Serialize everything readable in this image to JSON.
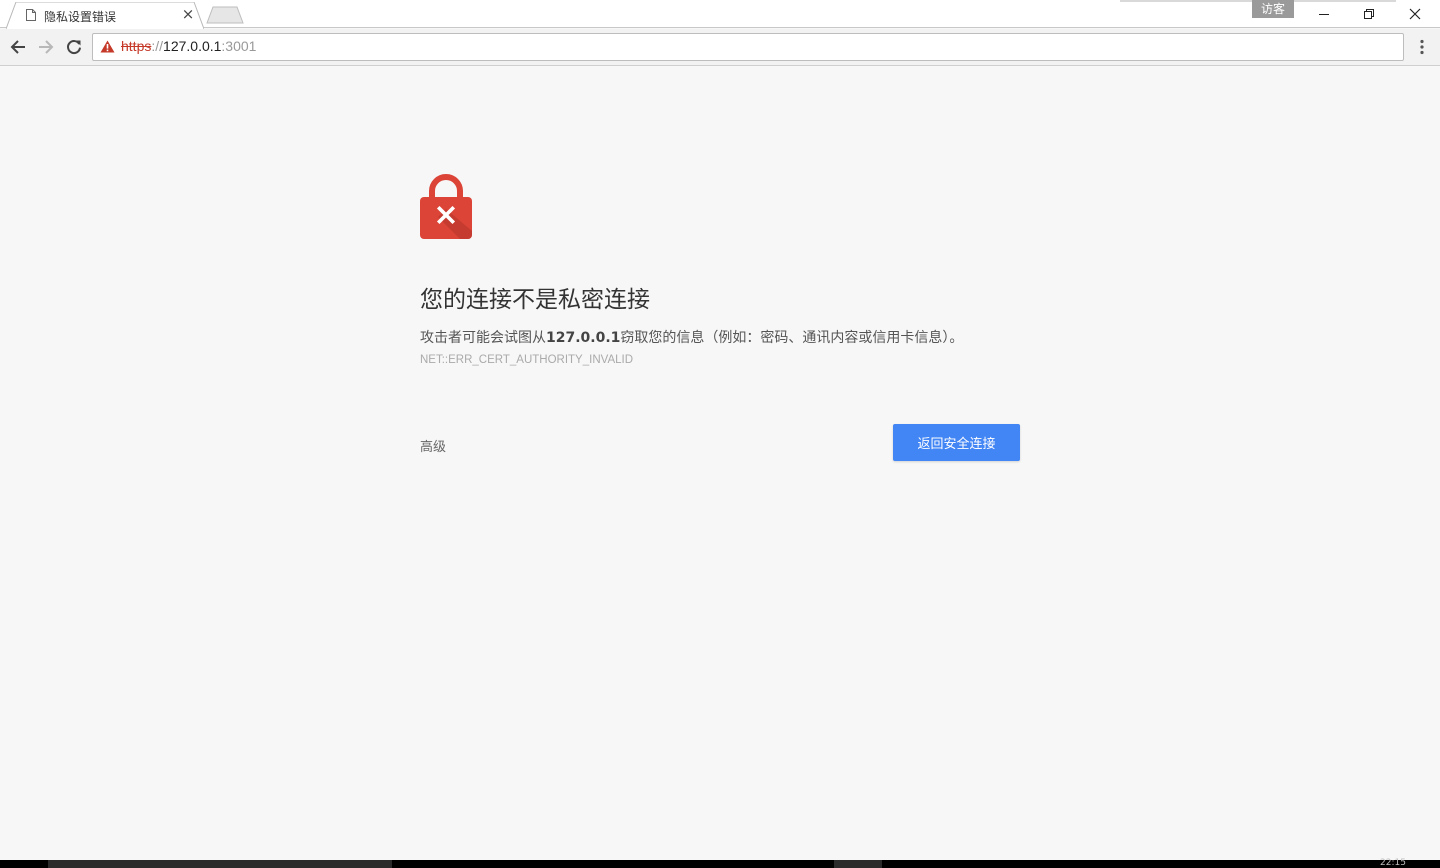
{
  "tab": {
    "title": "隐私设置错误",
    "favicon": "document-icon",
    "close_label": "×"
  },
  "profile": {
    "label": "访客"
  },
  "window_controls": [
    "minimize-icon",
    "restore-icon",
    "close-icon"
  ],
  "toolbar": {
    "nav_icons": [
      "back-arrow-icon",
      "forward-arrow-icon",
      "reload-icon"
    ],
    "url": {
      "scheme": "https",
      "separator": "://",
      "host": "127.0.0.1",
      "port": ":3001"
    },
    "security_state": "not-secure",
    "menu_icon": "three-dot-menu-icon"
  },
  "interstitial": {
    "icon": "red-lock-x-icon",
    "heading": "您的连接不是私密连接",
    "body_prefix": "攻击者可能会试图从",
    "body_host": "127.0.0.1",
    "body_suffix": "窃取您的信息（例如：密码、通讯内容或信用卡信息）。",
    "error_code": "NET::ERR_CERT_AUTHORITY_INVALID",
    "advanced_label": "高级",
    "primary_button": "返回安全连接"
  },
  "taskbar": {
    "clock": "22:15"
  },
  "colors": {
    "accent_button": "#4285f4",
    "lock_red": "#db4437",
    "scheme_strike": "#c53929",
    "page_background": "#f7f7f7"
  }
}
